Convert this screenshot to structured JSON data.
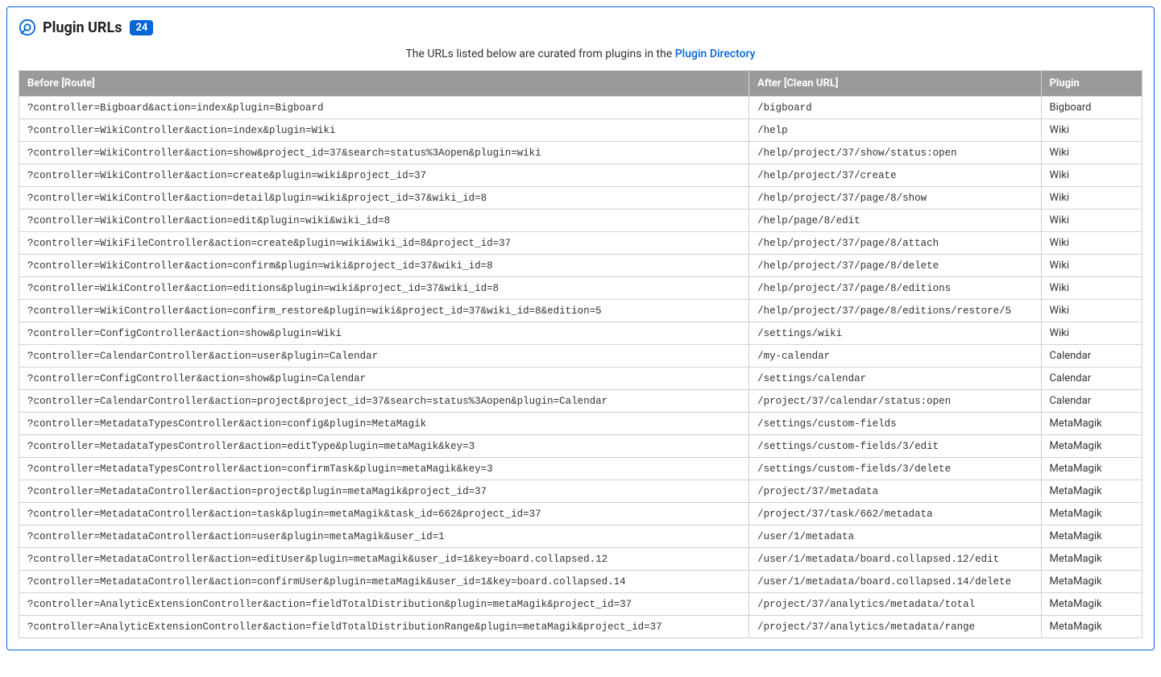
{
  "header": {
    "title": "Plugin URLs",
    "count": "24"
  },
  "intro": {
    "text_before": "The URLs listed below are curated from plugins in the ",
    "link_text": "Plugin Directory"
  },
  "table": {
    "headers": {
      "before": "Before [Route]",
      "after": "After [Clean URL]",
      "plugin": "Plugin"
    },
    "rows": [
      {
        "before": "?controller=Bigboard&action=index&plugin=Bigboard",
        "after": "/bigboard",
        "plugin": "Bigboard"
      },
      {
        "before": "?controller=WikiController&action=index&plugin=Wiki",
        "after": "/help",
        "plugin": "Wiki"
      },
      {
        "before": "?controller=WikiController&action=show&project_id=37&search=status%3Aopen&plugin=wiki",
        "after": "/help/project/37/show/status:open",
        "plugin": "Wiki"
      },
      {
        "before": "?controller=WikiController&action=create&plugin=wiki&project_id=37",
        "after": "/help/project/37/create",
        "plugin": "Wiki"
      },
      {
        "before": "?controller=WikiController&action=detail&plugin=wiki&project_id=37&wiki_id=8",
        "after": "/help/project/37/page/8/show",
        "plugin": "Wiki"
      },
      {
        "before": "?controller=WikiController&action=edit&plugin=wiki&wiki_id=8",
        "after": "/help/page/8/edit",
        "plugin": "Wiki"
      },
      {
        "before": "?controller=WikiFileController&action=create&plugin=wiki&wiki_id=8&project_id=37",
        "after": "/help/project/37/page/8/attach",
        "plugin": "Wiki"
      },
      {
        "before": "?controller=WikiController&action=confirm&plugin=wiki&project_id=37&wiki_id=8",
        "after": "/help/project/37/page/8/delete",
        "plugin": "Wiki"
      },
      {
        "before": "?controller=WikiController&action=editions&plugin=wiki&project_id=37&wiki_id=8",
        "after": "/help/project/37/page/8/editions",
        "plugin": "Wiki"
      },
      {
        "before": "?controller=WikiController&action=confirm_restore&plugin=wiki&project_id=37&wiki_id=8&edition=5",
        "after": "/help/project/37/page/8/editions/restore/5",
        "plugin": "Wiki"
      },
      {
        "before": "?controller=ConfigController&action=show&plugin=Wiki",
        "after": "/settings/wiki",
        "plugin": "Wiki"
      },
      {
        "before": "?controller=CalendarController&action=user&plugin=Calendar",
        "after": "/my-calendar",
        "plugin": "Calendar"
      },
      {
        "before": "?controller=ConfigController&action=show&plugin=Calendar",
        "after": "/settings/calendar",
        "plugin": "Calendar"
      },
      {
        "before": "?controller=CalendarController&action=project&project_id=37&search=status%3Aopen&plugin=Calendar",
        "after": "/project/37/calendar/status:open",
        "plugin": "Calendar"
      },
      {
        "before": "?controller=MetadataTypesController&action=config&plugin=MetaMagik",
        "after": "/settings/custom-fields",
        "plugin": "MetaMagik"
      },
      {
        "before": "?controller=MetadataTypesController&action=editType&plugin=metaMagik&key=3",
        "after": "/settings/custom-fields/3/edit",
        "plugin": "MetaMagik"
      },
      {
        "before": "?controller=MetadataTypesController&action=confirmTask&plugin=metaMagik&key=3",
        "after": "/settings/custom-fields/3/delete",
        "plugin": "MetaMagik"
      },
      {
        "before": "?controller=MetadataController&action=project&plugin=metaMagik&project_id=37",
        "after": "/project/37/metadata",
        "plugin": "MetaMagik"
      },
      {
        "before": "?controller=MetadataController&action=task&plugin=metaMagik&task_id=662&project_id=37",
        "after": "/project/37/task/662/metadata",
        "plugin": "MetaMagik"
      },
      {
        "before": "?controller=MetadataController&action=user&plugin=metaMagik&user_id=1",
        "after": "/user/1/metadata",
        "plugin": "MetaMagik"
      },
      {
        "before": "?controller=MetadataController&action=editUser&plugin=metaMagik&user_id=1&key=board.collapsed.12",
        "after": "/user/1/metadata/board.collapsed.12/edit",
        "plugin": "MetaMagik"
      },
      {
        "before": "?controller=MetadataController&action=confirmUser&plugin=metaMagik&user_id=1&key=board.collapsed.14",
        "after": "/user/1/metadata/board.collapsed.14/delete",
        "plugin": "MetaMagik"
      },
      {
        "before": "?controller=AnalyticExtensionController&action=fieldTotalDistribution&plugin=metaMagik&project_id=37",
        "after": "/project/37/analytics/metadata/total",
        "plugin": "MetaMagik"
      },
      {
        "before": "?controller=AnalyticExtensionController&action=fieldTotalDistributionRange&plugin=metaMagik&project_id=37",
        "after": "/project/37/analytics/metadata/range",
        "plugin": "MetaMagik"
      }
    ]
  }
}
